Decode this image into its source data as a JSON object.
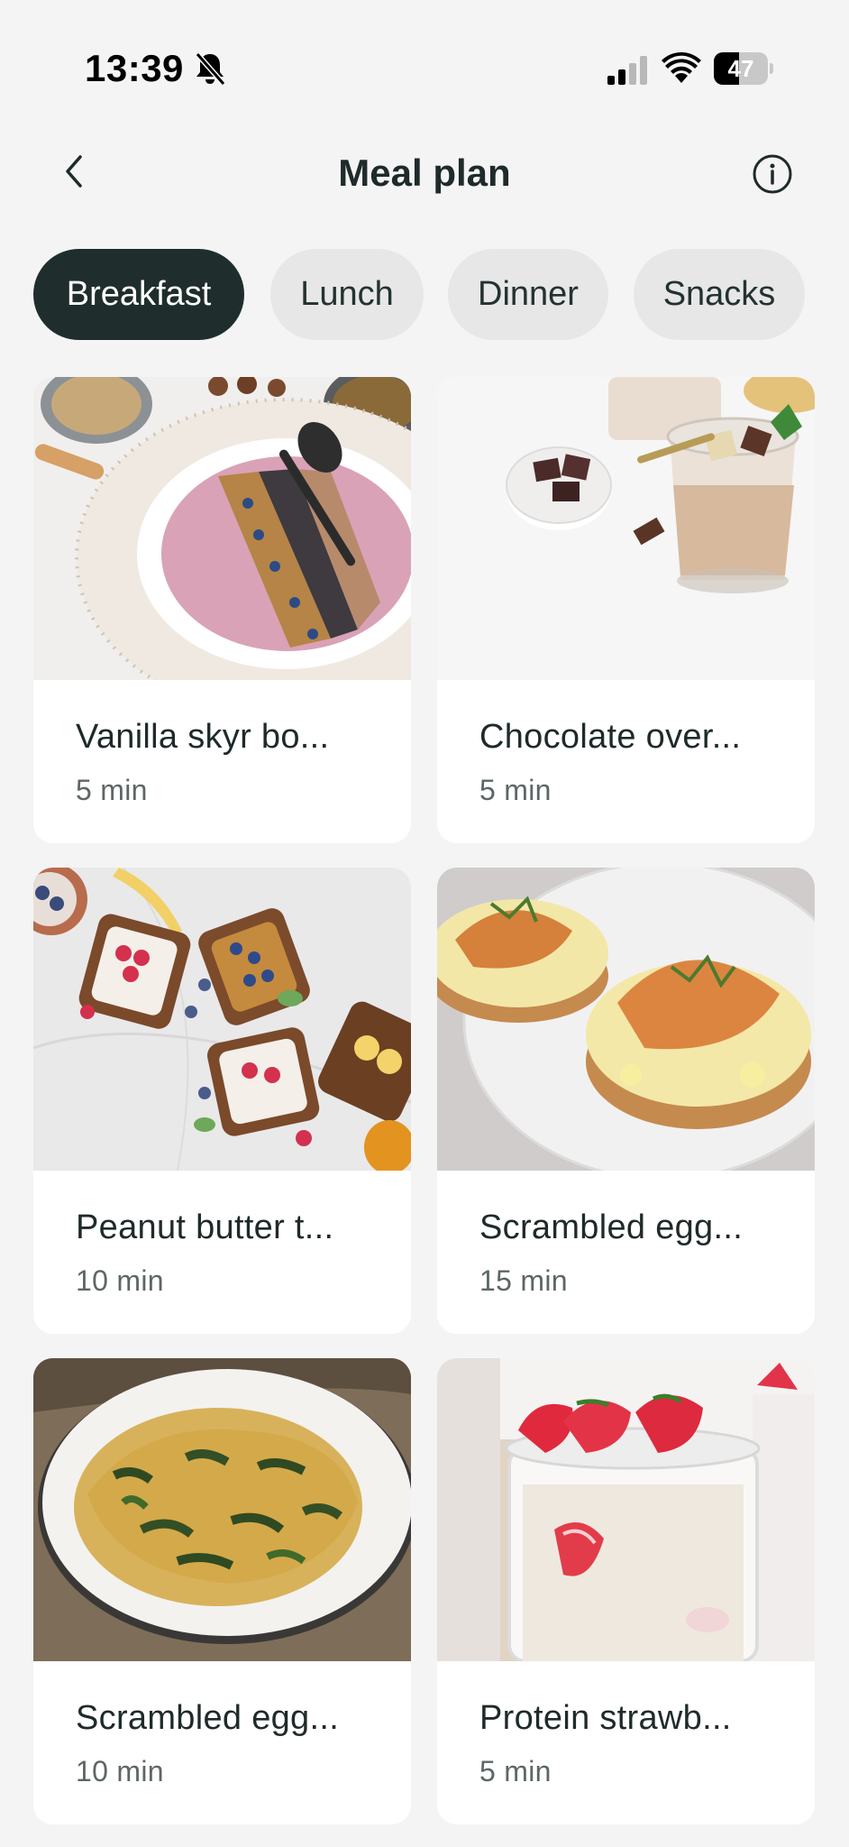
{
  "status_bar": {
    "time": "13:39",
    "battery_level": "47",
    "battery_fraction": 0.47,
    "icons": [
      "bell-slash-icon",
      "signal-icon",
      "wifi-icon",
      "battery-icon"
    ]
  },
  "header": {
    "title": "Meal plan",
    "back_icon": "chevron-left-icon",
    "info_icon": "info-circle-icon"
  },
  "tabs": [
    {
      "label": "Breakfast",
      "active": true
    },
    {
      "label": "Lunch",
      "active": false
    },
    {
      "label": "Dinner",
      "active": false
    },
    {
      "label": "Snacks",
      "active": false
    }
  ],
  "meals": [
    {
      "title": "Vanilla skyr bo...",
      "time": "5 min",
      "image": "smoothie-bowl-photo"
    },
    {
      "title": "Chocolate over...",
      "time": "5 min",
      "image": "overnight-oats-chocolate-photo"
    },
    {
      "title": "Peanut butter t...",
      "time": "10 min",
      "image": "peanut-butter-toast-photo"
    },
    {
      "title": "Scrambled egg...",
      "time": "15 min",
      "image": "eggs-salmon-bagel-photo"
    },
    {
      "title": "Scrambled egg...",
      "time": "10 min",
      "image": "eggs-spinach-plate-photo"
    },
    {
      "title": "Protein strawb...",
      "time": "5 min",
      "image": "strawberry-oats-jar-photo"
    }
  ],
  "colors": {
    "background": "#f4f4f4",
    "tab_active": "#1f2d2d",
    "tab_inactive": "#e6e7e6",
    "card": "#ffffff",
    "text_primary": "#1f2a2a",
    "text_secondary": "#5d6666"
  }
}
